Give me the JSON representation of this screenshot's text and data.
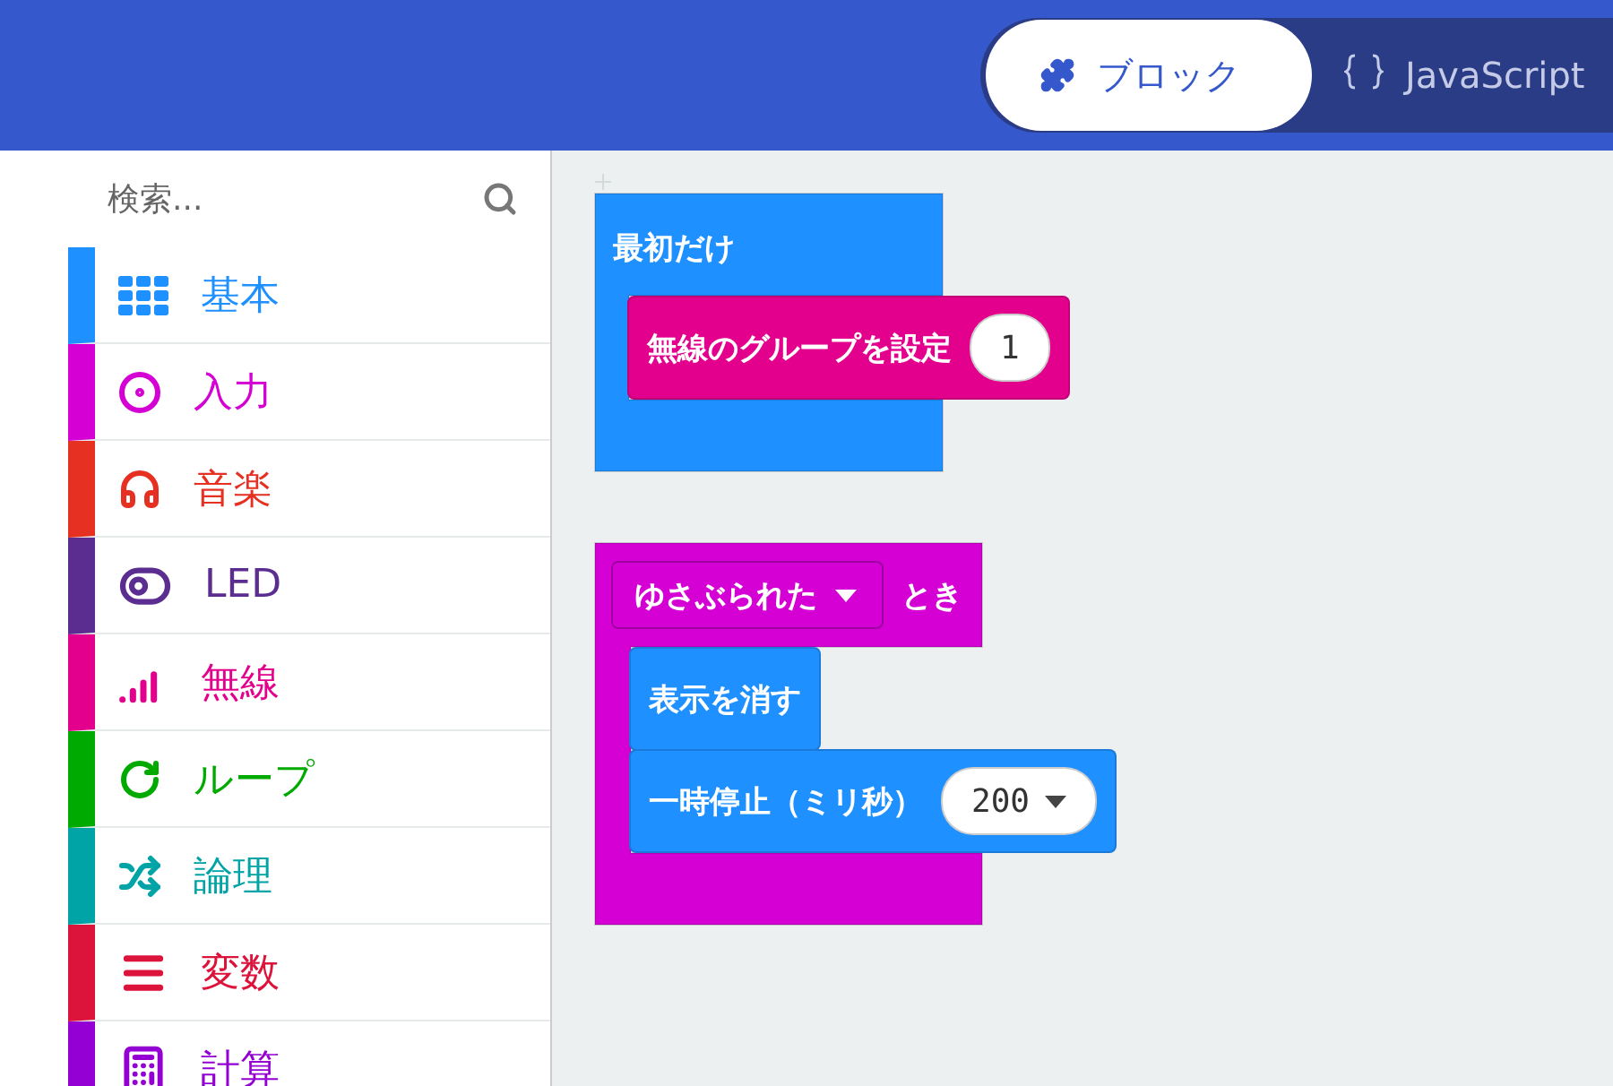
{
  "header": {
    "tabs": [
      {
        "label": "ブロック",
        "selected": true,
        "kind": "blocks"
      },
      {
        "label": "JavaScript",
        "selected": false,
        "kind": "code"
      }
    ]
  },
  "sidebar": {
    "search": {
      "placeholder": "検索..."
    },
    "categories": [
      {
        "label": "基本",
        "color": "#1e90ff",
        "kind": "grid"
      },
      {
        "label": "入力",
        "color": "#d400d4",
        "kind": "target"
      },
      {
        "label": "音楽",
        "color": "#e63022",
        "kind": "headphones"
      },
      {
        "label": "LED",
        "color": "#5c2d91",
        "kind": "toggle"
      },
      {
        "label": "無線",
        "color": "#e3008c",
        "kind": "signal"
      },
      {
        "label": "ループ",
        "color": "#00aa00",
        "kind": "loop"
      },
      {
        "label": "論理",
        "color": "#00a4a6",
        "kind": "shuffle"
      },
      {
        "label": "変数",
        "color": "#dc143c",
        "kind": "lines"
      },
      {
        "label": "計算",
        "color": "#9400d3",
        "kind": "calculator"
      }
    ]
  },
  "workspace": {
    "on_start": {
      "label": "最初だけ",
      "color": "#1e90ff",
      "children": [
        {
          "label": "無線のグループを設定",
          "value": "1",
          "color": "#e3008c"
        }
      ]
    },
    "on_gesture": {
      "dropdown": "ゆさぶられた",
      "suffix": "とき",
      "color": "#d400d4",
      "children": [
        {
          "label": "表示を消す",
          "color": "#1e90ff"
        },
        {
          "label": "一時停止（ミリ秒）",
          "value": "200",
          "dropdown": true,
          "color": "#1e90ff"
        }
      ]
    }
  }
}
